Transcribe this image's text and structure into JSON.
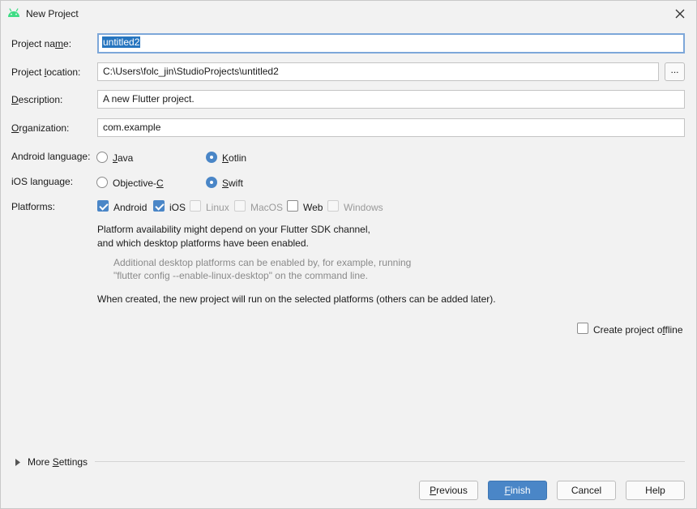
{
  "window": {
    "title": "New Project"
  },
  "fields": {
    "project_name": {
      "label_pre": "Project na",
      "label_ul": "m",
      "label_post": "e:",
      "value": "untitled2"
    },
    "project_location": {
      "label_pre": "Project ",
      "label_ul": "l",
      "label_post": "ocation:",
      "value": "C:\\Users\\folc_jin\\StudioProjects\\untitled2",
      "browse_label": "..."
    },
    "description": {
      "label_pre": "",
      "label_ul": "D",
      "label_post": "escription:",
      "value": "A new Flutter project."
    },
    "organization": {
      "label_pre": "",
      "label_ul": "O",
      "label_post": "rganization:",
      "value": "com.example"
    }
  },
  "android_language": {
    "label": "Android language:",
    "options": [
      {
        "pre": "",
        "ul": "J",
        "post": "ava",
        "selected": false
      },
      {
        "pre": "",
        "ul": "K",
        "post": "otlin",
        "selected": true
      }
    ]
  },
  "ios_language": {
    "label": "iOS language:",
    "options": [
      {
        "pre": "Objective-",
        "ul": "C",
        "post": "",
        "selected": false
      },
      {
        "pre": "",
        "ul": "S",
        "post": "wift",
        "selected": true
      }
    ]
  },
  "platforms": {
    "label": "Platforms:",
    "items": [
      {
        "label": "Android",
        "checked": true,
        "enabled": true
      },
      {
        "label": "iOS",
        "checked": true,
        "enabled": true
      },
      {
        "label": "Linux",
        "checked": false,
        "enabled": false
      },
      {
        "label": "MacOS",
        "checked": false,
        "enabled": false
      },
      {
        "label": "Web",
        "checked": false,
        "enabled": true
      },
      {
        "label": "Windows",
        "checked": false,
        "enabled": false
      }
    ]
  },
  "notes": {
    "availability_line1": "Platform availability might depend on your Flutter SDK channel,",
    "availability_line2": "and which desktop platforms have been enabled.",
    "hint_line1": "Additional desktop platforms can be enabled by, for example, running",
    "hint_line2": "\"flutter config --enable-linux-desktop\" on the command line.",
    "when_created": "When created, the new project will run on the selected platforms (others can be added later)."
  },
  "offline": {
    "label_pre": "Create project o",
    "label_ul": "f",
    "label_post": "fline",
    "checked": false
  },
  "more_settings": {
    "label_pre": "More ",
    "label_ul": "S",
    "label_post": "ettings"
  },
  "buttons": {
    "previous": {
      "pre": "",
      "ul": "P",
      "post": "revious"
    },
    "finish": {
      "pre": "",
      "ul": "F",
      "post": "inish"
    },
    "cancel": "Cancel",
    "help": "Help"
  },
  "colors": {
    "accent": "#4a86c7",
    "selection": "#2675bf",
    "android_icon": "#3ddc84",
    "focus_border": "#7da7d9",
    "disabled_text": "#9a9a9a"
  },
  "icons": {
    "app": "android-icon",
    "close": "close-icon",
    "more_settings": "chevron-right-icon"
  }
}
